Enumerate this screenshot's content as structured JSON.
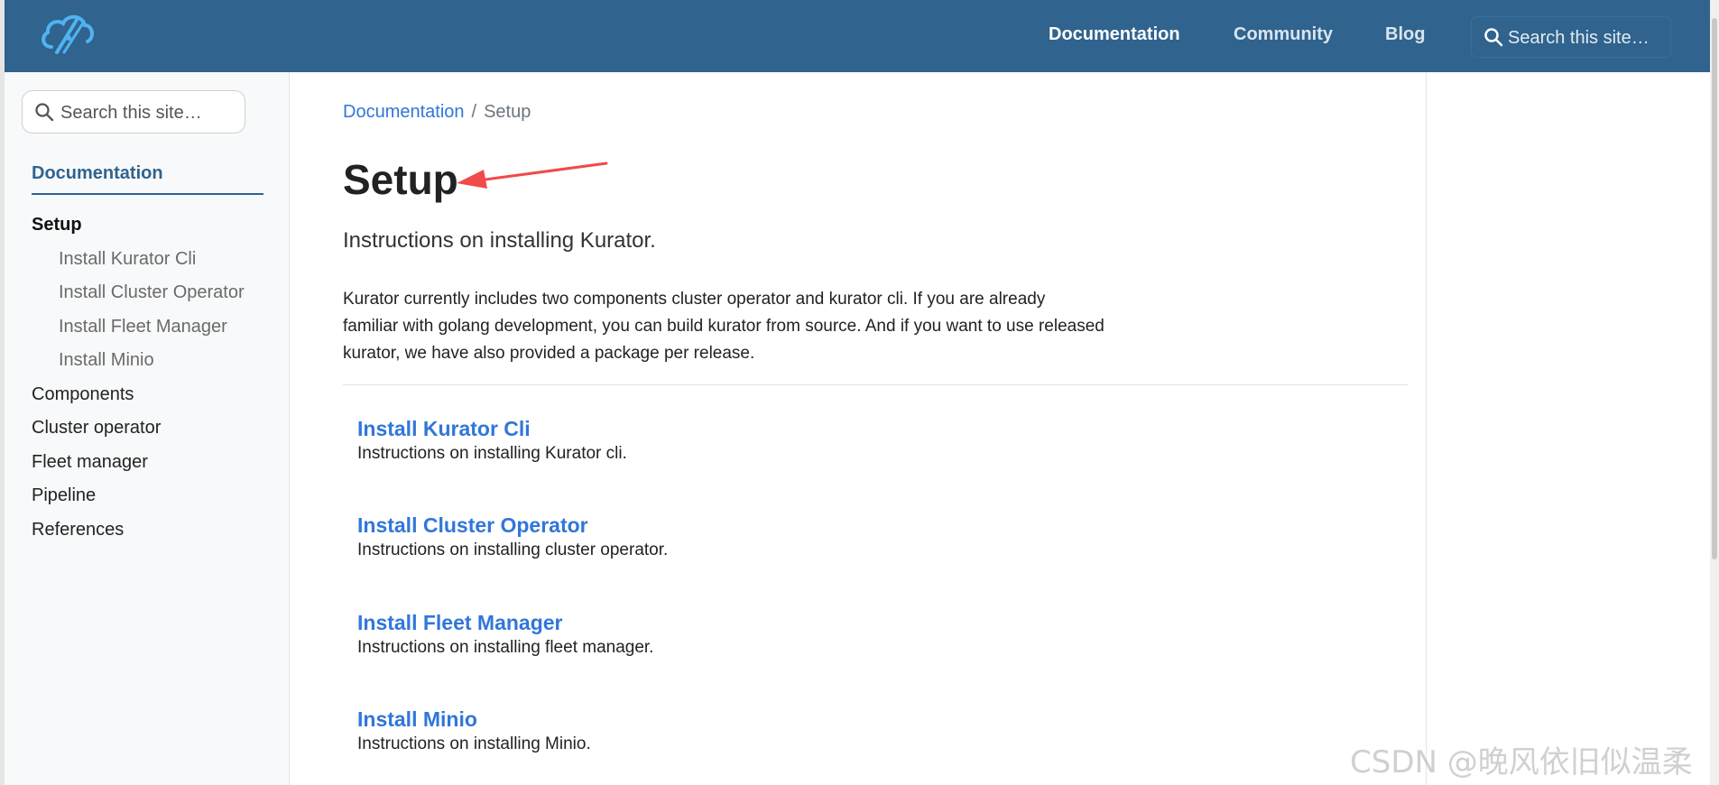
{
  "navbar": {
    "links": [
      {
        "label": "Documentation",
        "active": true
      },
      {
        "label": "Community",
        "active": false
      },
      {
        "label": "Blog",
        "active": false
      }
    ],
    "search_placeholder": "Search this site…",
    "logo_icon": "cloud-logo-icon",
    "bg_color": "#30638e"
  },
  "sidebar": {
    "search_placeholder": "Search this site…",
    "section_title": "Documentation",
    "current_item": "Setup",
    "sub_items": [
      "Install Kurator Cli",
      "Install Cluster Operator",
      "Install Fleet Manager",
      "Install Minio"
    ],
    "items": [
      "Components",
      "Cluster operator",
      "Fleet manager",
      "Pipeline",
      "References"
    ]
  },
  "main": {
    "breadcrumb": {
      "parent": "Documentation",
      "separator": "/",
      "current": "Setup"
    },
    "title": "Setup",
    "lead": "Instructions on installing Kurator.",
    "intro_lines": [
      "Kurator currently includes two components cluster operator and kurator cli. If you are already",
      "familiar with golang development, you can build kurator from source. And if you want to use released",
      "kurator, we have also provided a package per release."
    ],
    "entries": [
      {
        "title": "Install Kurator Cli",
        "desc": "Instructions on installing Kurator cli."
      },
      {
        "title": "Install Cluster Operator",
        "desc": "Instructions on installing cluster operator."
      },
      {
        "title": "Install Fleet Manager",
        "desc": "Instructions on installing fleet manager."
      },
      {
        "title": "Install Minio",
        "desc": "Instructions on installing Minio."
      }
    ]
  },
  "annotation": {
    "color": "#f04a4a",
    "icon": "red-arrow-annotation"
  },
  "watermark": "CSDN @晚风依旧似温柔",
  "colors": {
    "link": "#3176d9",
    "brand": "#30638e"
  }
}
